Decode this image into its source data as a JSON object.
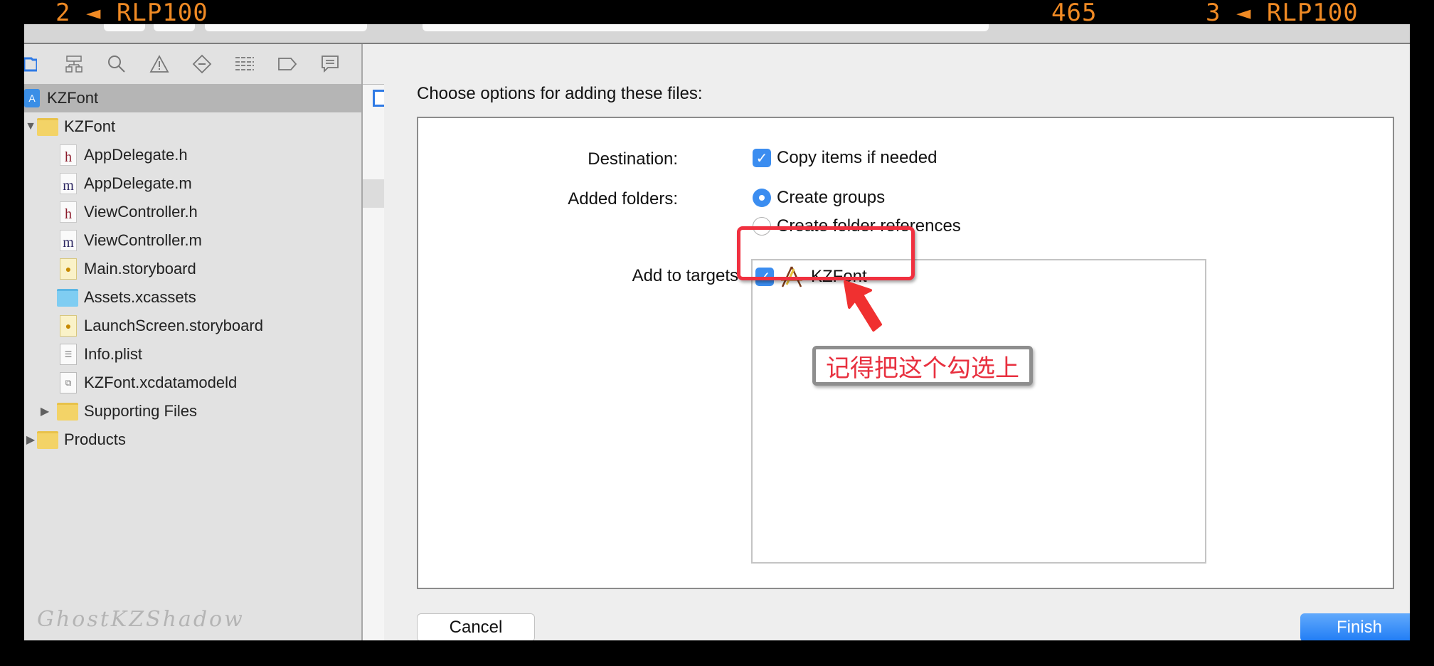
{
  "overlay": {
    "left": "2 ◄ RLP100",
    "middle": "465",
    "right": "3 ◄ RLP100",
    "color": "#f08a24"
  },
  "navigator": {
    "icons": [
      "folder-icon",
      "hierarchy-icon",
      "search-icon",
      "warning-icon",
      "test-diamond-icon",
      "list-icon",
      "tag-icon",
      "comment-icon"
    ],
    "tree": [
      {
        "label": "KZFont",
        "type": "project",
        "level": 0,
        "selected": true
      },
      {
        "label": "KZFont",
        "type": "folder",
        "level": 0,
        "expanded": true
      },
      {
        "label": "AppDelegate.h",
        "type": "h",
        "level": 1
      },
      {
        "label": "AppDelegate.m",
        "type": "m",
        "level": 1
      },
      {
        "label": "ViewController.h",
        "type": "h",
        "level": 1
      },
      {
        "label": "ViewController.m",
        "type": "m",
        "level": 1
      },
      {
        "label": "Main.storyboard",
        "type": "storyboard",
        "level": 1
      },
      {
        "label": "Assets.xcassets",
        "type": "assets",
        "level": 1
      },
      {
        "label": "LaunchScreen.storyboard",
        "type": "storyboard",
        "level": 1
      },
      {
        "label": "Info.plist",
        "type": "plist",
        "level": 1
      },
      {
        "label": "KZFont.xcdatamodeld",
        "type": "datamodel",
        "level": 1
      },
      {
        "label": "Supporting Files",
        "type": "folder",
        "level": 1,
        "expanded": false
      },
      {
        "label": "Products",
        "type": "folder",
        "level": 0,
        "expanded": false
      }
    ],
    "watermark": "GhostKZShadow"
  },
  "dialog": {
    "title": "Choose options for adding these files:",
    "destination": {
      "label": "Destination:",
      "option": "Copy items if needed",
      "checked": true
    },
    "added_folders": {
      "label": "Added folders:",
      "options": [
        {
          "label": "Create groups",
          "selected": true
        },
        {
          "label": "Create folder references",
          "selected": false
        }
      ]
    },
    "targets": {
      "label": "Add to targets",
      "items": [
        {
          "label": "KZFont",
          "checked": true
        }
      ]
    },
    "cancel_label": "Cancel",
    "finish_label": "Finish",
    "accent": "#3b8df0"
  },
  "annotation": {
    "callout_text": "记得把这个勾选上",
    "color": "#e8303f"
  }
}
